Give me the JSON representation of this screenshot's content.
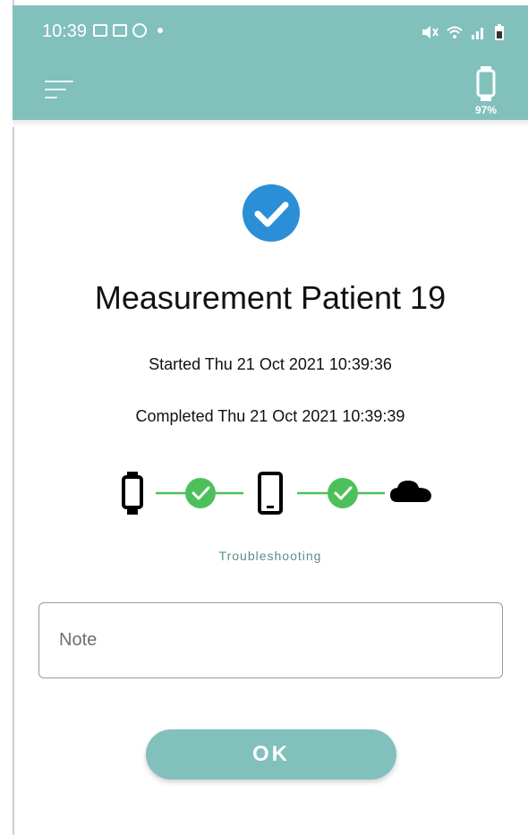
{
  "status_bar": {
    "time": "10:39",
    "left_icons": [
      "video-icon",
      "image-icon",
      "record-icon"
    ],
    "right_icons": [
      "mute-icon",
      "wifi-icon",
      "signal-icon",
      "battery-icon"
    ]
  },
  "app_bar": {
    "menu_icon": "menu-icon",
    "device_icon": "wristband-icon",
    "device_battery": "97%"
  },
  "result": {
    "status_icon": "check-circle-icon",
    "title": "Measurement Patient 19",
    "started": "Started Thu 21 Oct 2021 10:39:36",
    "completed": "Completed  Thu 21 Oct 2021 10:39:39"
  },
  "sync_chain": {
    "nodes": [
      "wristband-icon",
      "phone-icon",
      "cloud-icon"
    ],
    "links_ok": [
      true,
      true
    ]
  },
  "troubleshooting_label": "Troubleshooting",
  "note": {
    "placeholder": "Note",
    "value": ""
  },
  "ok_label": "OK",
  "colors": {
    "accent": "#82c0bc",
    "check_blue": "#2a8fd6",
    "success_green": "#4cc15b"
  }
}
